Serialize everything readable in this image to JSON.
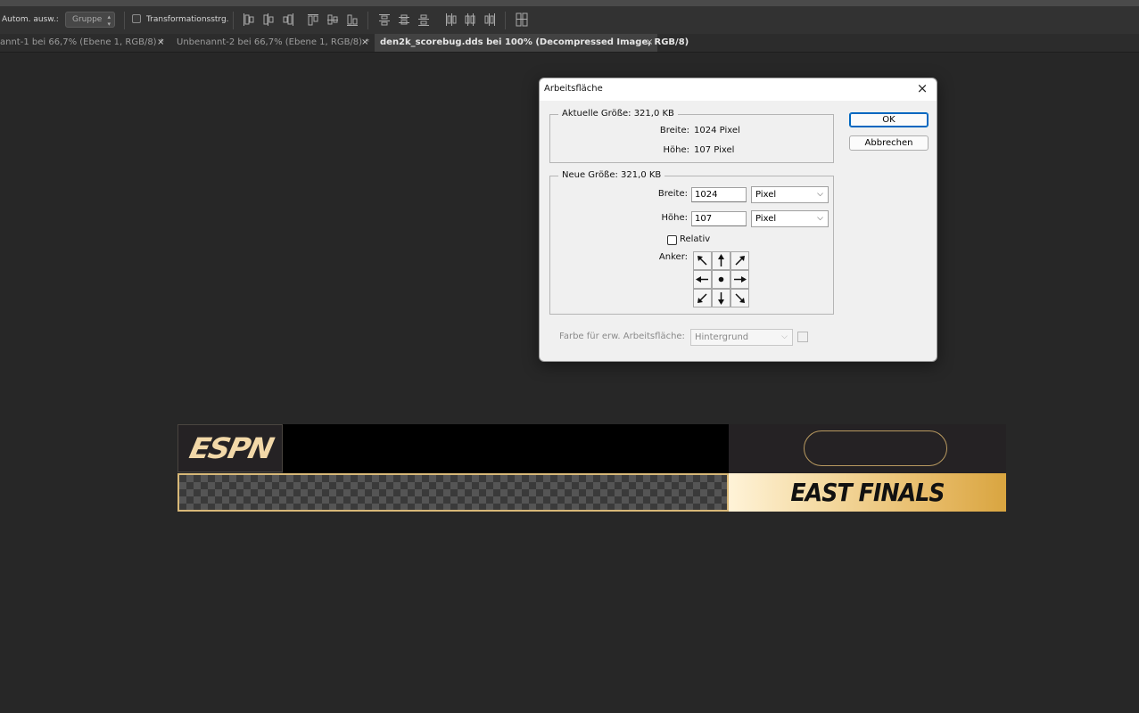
{
  "options_bar": {
    "auto_select_label": "Autom. ausw.:",
    "auto_select_value": "Gruppe",
    "transform_controls_label": "Transformationsstrg."
  },
  "tabs": [
    {
      "label": "annt-1 bei 66,7% (Ebene 1, RGB/8) *",
      "close": "×",
      "active": false
    },
    {
      "label": "Unbenannt-2 bei 66,7% (Ebene 1, RGB/8) *",
      "close": "×",
      "active": false
    },
    {
      "label": "den2k_scorebug.dds bei 100% (Decompressed Image, RGB/8)",
      "close": "×",
      "active": true
    }
  ],
  "canvas": {
    "logo_text": "ESPN",
    "banner_text": "EAST FINALS",
    "colors": {
      "gold": "#d8b878",
      "dark": "#252224"
    }
  },
  "dialog": {
    "title": "Arbeitsfläche",
    "close": "×",
    "current_size": {
      "legend": "Aktuelle Größe: 321,0 KB",
      "width_label": "Breite:",
      "width_value": "1024 Pixel",
      "height_label": "Höhe:",
      "height_value": "107 Pixel"
    },
    "new_size": {
      "legend": "Neue Größe: 321,0 KB",
      "width_label": "Breite:",
      "width_value": "1024",
      "width_unit": "Pixel",
      "height_label": "Höhe:",
      "height_value": "107",
      "height_unit": "Pixel",
      "relative_label": "Relativ",
      "anchor_label": "Anker:"
    },
    "extension_color_label": "Farbe für erw. Arbeitsfläche:",
    "extension_color_value": "Hintergrund",
    "ok_label": "OK",
    "cancel_label": "Abbrechen"
  }
}
